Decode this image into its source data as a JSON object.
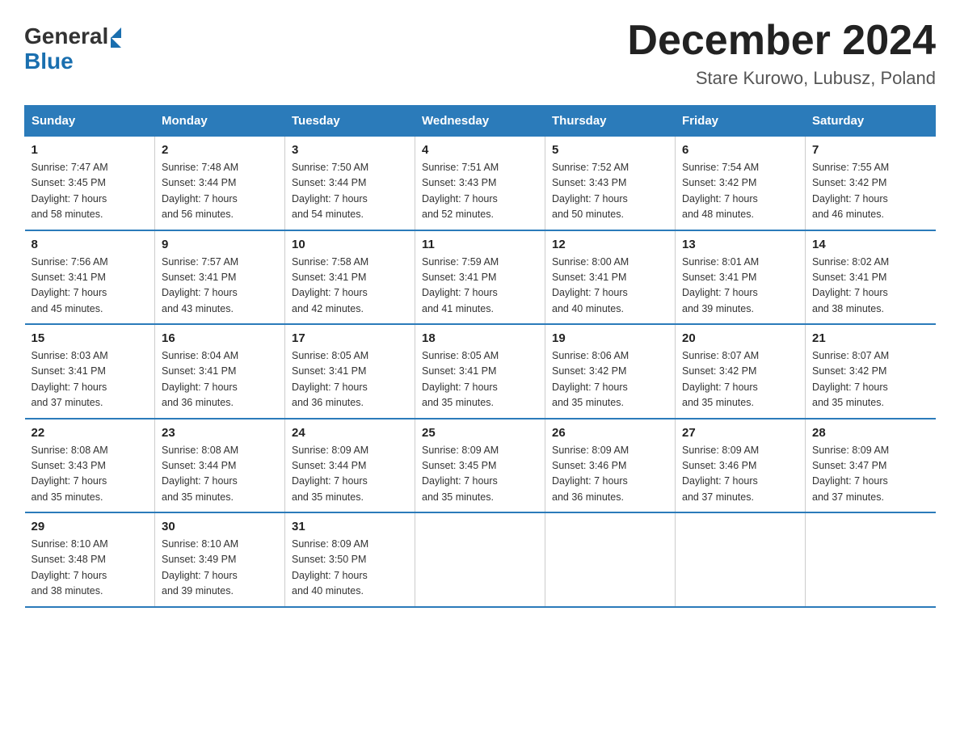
{
  "header": {
    "logo_general": "General",
    "logo_blue": "Blue",
    "month_title": "December 2024",
    "location": "Stare Kurowo, Lubusz, Poland"
  },
  "days_of_week": [
    "Sunday",
    "Monday",
    "Tuesday",
    "Wednesday",
    "Thursday",
    "Friday",
    "Saturday"
  ],
  "weeks": [
    [
      {
        "day": "1",
        "info": "Sunrise: 7:47 AM\nSunset: 3:45 PM\nDaylight: 7 hours\nand 58 minutes."
      },
      {
        "day": "2",
        "info": "Sunrise: 7:48 AM\nSunset: 3:44 PM\nDaylight: 7 hours\nand 56 minutes."
      },
      {
        "day": "3",
        "info": "Sunrise: 7:50 AM\nSunset: 3:44 PM\nDaylight: 7 hours\nand 54 minutes."
      },
      {
        "day": "4",
        "info": "Sunrise: 7:51 AM\nSunset: 3:43 PM\nDaylight: 7 hours\nand 52 minutes."
      },
      {
        "day": "5",
        "info": "Sunrise: 7:52 AM\nSunset: 3:43 PM\nDaylight: 7 hours\nand 50 minutes."
      },
      {
        "day": "6",
        "info": "Sunrise: 7:54 AM\nSunset: 3:42 PM\nDaylight: 7 hours\nand 48 minutes."
      },
      {
        "day": "7",
        "info": "Sunrise: 7:55 AM\nSunset: 3:42 PM\nDaylight: 7 hours\nand 46 minutes."
      }
    ],
    [
      {
        "day": "8",
        "info": "Sunrise: 7:56 AM\nSunset: 3:41 PM\nDaylight: 7 hours\nand 45 minutes."
      },
      {
        "day": "9",
        "info": "Sunrise: 7:57 AM\nSunset: 3:41 PM\nDaylight: 7 hours\nand 43 minutes."
      },
      {
        "day": "10",
        "info": "Sunrise: 7:58 AM\nSunset: 3:41 PM\nDaylight: 7 hours\nand 42 minutes."
      },
      {
        "day": "11",
        "info": "Sunrise: 7:59 AM\nSunset: 3:41 PM\nDaylight: 7 hours\nand 41 minutes."
      },
      {
        "day": "12",
        "info": "Sunrise: 8:00 AM\nSunset: 3:41 PM\nDaylight: 7 hours\nand 40 minutes."
      },
      {
        "day": "13",
        "info": "Sunrise: 8:01 AM\nSunset: 3:41 PM\nDaylight: 7 hours\nand 39 minutes."
      },
      {
        "day": "14",
        "info": "Sunrise: 8:02 AM\nSunset: 3:41 PM\nDaylight: 7 hours\nand 38 minutes."
      }
    ],
    [
      {
        "day": "15",
        "info": "Sunrise: 8:03 AM\nSunset: 3:41 PM\nDaylight: 7 hours\nand 37 minutes."
      },
      {
        "day": "16",
        "info": "Sunrise: 8:04 AM\nSunset: 3:41 PM\nDaylight: 7 hours\nand 36 minutes."
      },
      {
        "day": "17",
        "info": "Sunrise: 8:05 AM\nSunset: 3:41 PM\nDaylight: 7 hours\nand 36 minutes."
      },
      {
        "day": "18",
        "info": "Sunrise: 8:05 AM\nSunset: 3:41 PM\nDaylight: 7 hours\nand 35 minutes."
      },
      {
        "day": "19",
        "info": "Sunrise: 8:06 AM\nSunset: 3:42 PM\nDaylight: 7 hours\nand 35 minutes."
      },
      {
        "day": "20",
        "info": "Sunrise: 8:07 AM\nSunset: 3:42 PM\nDaylight: 7 hours\nand 35 minutes."
      },
      {
        "day": "21",
        "info": "Sunrise: 8:07 AM\nSunset: 3:42 PM\nDaylight: 7 hours\nand 35 minutes."
      }
    ],
    [
      {
        "day": "22",
        "info": "Sunrise: 8:08 AM\nSunset: 3:43 PM\nDaylight: 7 hours\nand 35 minutes."
      },
      {
        "day": "23",
        "info": "Sunrise: 8:08 AM\nSunset: 3:44 PM\nDaylight: 7 hours\nand 35 minutes."
      },
      {
        "day": "24",
        "info": "Sunrise: 8:09 AM\nSunset: 3:44 PM\nDaylight: 7 hours\nand 35 minutes."
      },
      {
        "day": "25",
        "info": "Sunrise: 8:09 AM\nSunset: 3:45 PM\nDaylight: 7 hours\nand 35 minutes."
      },
      {
        "day": "26",
        "info": "Sunrise: 8:09 AM\nSunset: 3:46 PM\nDaylight: 7 hours\nand 36 minutes."
      },
      {
        "day": "27",
        "info": "Sunrise: 8:09 AM\nSunset: 3:46 PM\nDaylight: 7 hours\nand 37 minutes."
      },
      {
        "day": "28",
        "info": "Sunrise: 8:09 AM\nSunset: 3:47 PM\nDaylight: 7 hours\nand 37 minutes."
      }
    ],
    [
      {
        "day": "29",
        "info": "Sunrise: 8:10 AM\nSunset: 3:48 PM\nDaylight: 7 hours\nand 38 minutes."
      },
      {
        "day": "30",
        "info": "Sunrise: 8:10 AM\nSunset: 3:49 PM\nDaylight: 7 hours\nand 39 minutes."
      },
      {
        "day": "31",
        "info": "Sunrise: 8:09 AM\nSunset: 3:50 PM\nDaylight: 7 hours\nand 40 minutes."
      },
      {
        "day": "",
        "info": ""
      },
      {
        "day": "",
        "info": ""
      },
      {
        "day": "",
        "info": ""
      },
      {
        "day": "",
        "info": ""
      }
    ]
  ]
}
